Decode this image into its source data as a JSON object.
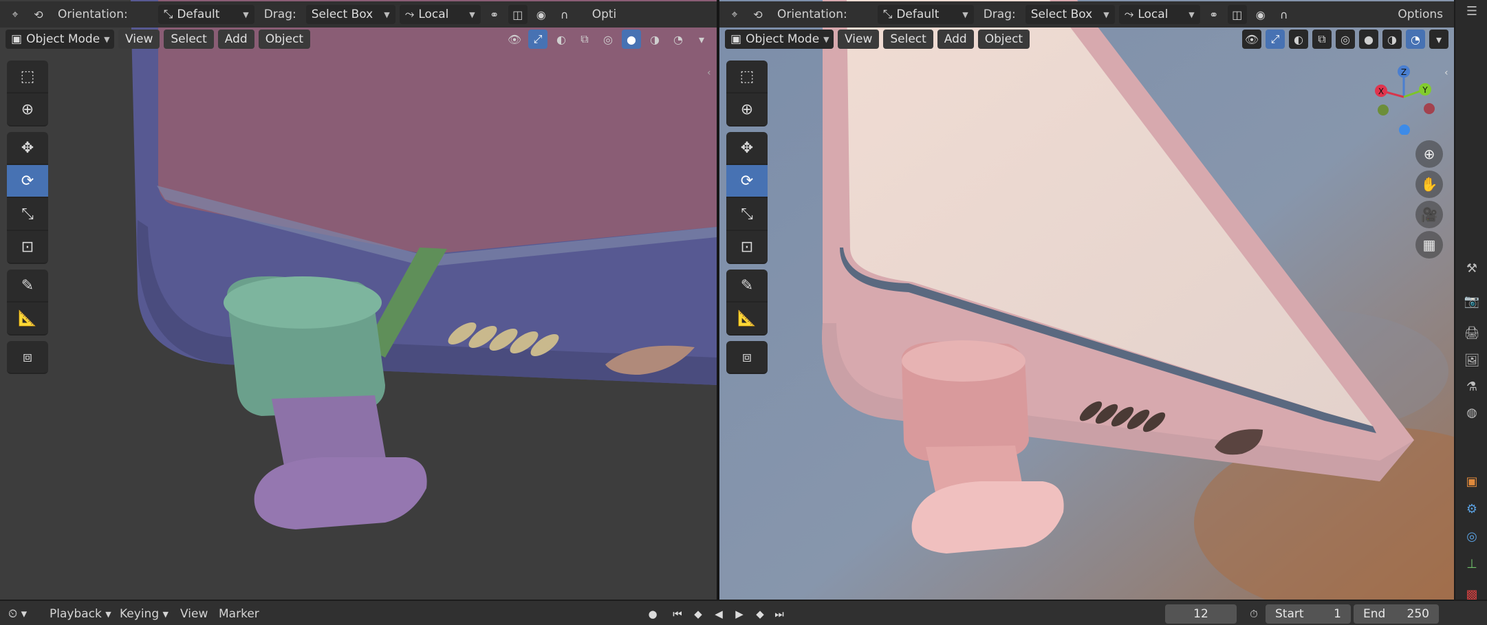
{
  "left_view": {
    "header": {
      "orientation_label": "Orientation:",
      "orientation_value": "Default",
      "drag_label": "Drag:",
      "drag_value": "Select Box",
      "pivot_value": "Local",
      "options_label": "Opti"
    },
    "subheader": {
      "mode": "Object Mode",
      "menu": [
        "View",
        "Select",
        "Add",
        "Object"
      ]
    },
    "shading": "solid"
  },
  "right_view": {
    "header": {
      "orientation_label": "Orientation:",
      "orientation_value": "Default",
      "drag_label": "Drag:",
      "drag_value": "Select Box",
      "pivot_value": "Local",
      "options_label": "Options"
    },
    "subheader": {
      "mode": "Object Mode",
      "menu": [
        "View",
        "Select",
        "Add",
        "Object"
      ]
    },
    "shading": "rendered",
    "gizmo": {
      "x": "X",
      "y": "Y",
      "z": "Z"
    }
  },
  "tools": [
    "select-box",
    "cursor",
    "move",
    "rotate",
    "scale",
    "transform",
    "annotate",
    "measure",
    "add-cube"
  ],
  "active_tool": "rotate",
  "timeline": {
    "menu": [
      "Playback",
      "Keying",
      "View",
      "Marker"
    ],
    "current_frame": "12",
    "start_label": "Start",
    "start_value": "1",
    "end_label": "End",
    "end_value": "250"
  },
  "colors": {
    "accent": "#4772b3",
    "header_bg": "#303030",
    "viewport_solid_bg": "#3d3d3d",
    "phone_body_solid": "#5a5b8e",
    "screen_solid": "#8a5d75",
    "connector_solid": "#6ba08c",
    "plug_solid": "#8d72a8",
    "phone_body_rendered": "#e7c3c6"
  }
}
